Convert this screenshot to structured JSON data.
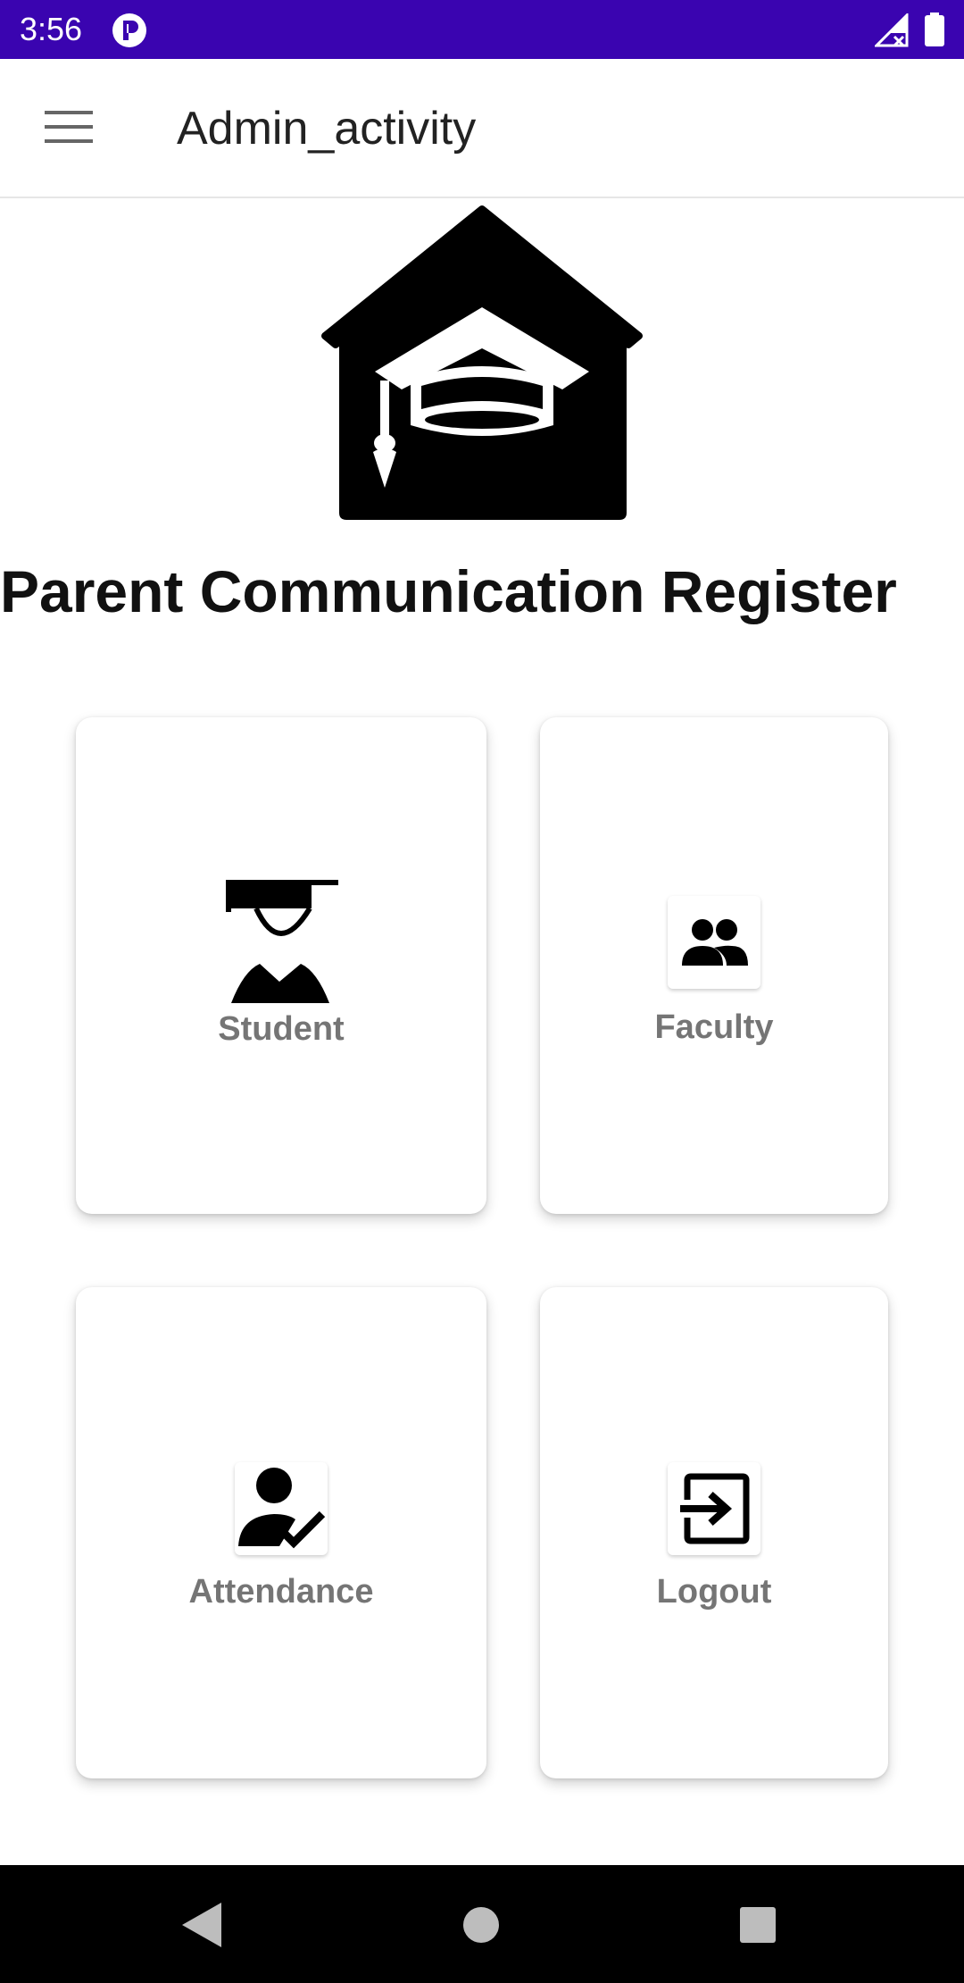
{
  "status_bar": {
    "time": "3:56",
    "icons": [
      "app-notification-icon",
      "signal-no-data-icon",
      "battery-icon"
    ]
  },
  "app_bar": {
    "title": "Admin_activity",
    "menu_icon": "hamburger-menu-icon"
  },
  "header": {
    "logo_icon": "school-house-graduation-cap-icon",
    "title": "Parent Communication Register"
  },
  "cards": [
    {
      "label": "Student",
      "icon": "student-graduate-icon"
    },
    {
      "label": "Faculty",
      "icon": "people-group-icon"
    },
    {
      "label": "Attendance",
      "icon": "person-check-icon"
    },
    {
      "label": "Logout",
      "icon": "exit-arrow-icon"
    }
  ],
  "nav_bar": {
    "icons": [
      "back-triangle-icon",
      "home-circle-icon",
      "recents-square-icon"
    ]
  },
  "colors": {
    "status_bar": "#3a04b0",
    "card_label": "#757575",
    "nav_bar": "#000000"
  }
}
